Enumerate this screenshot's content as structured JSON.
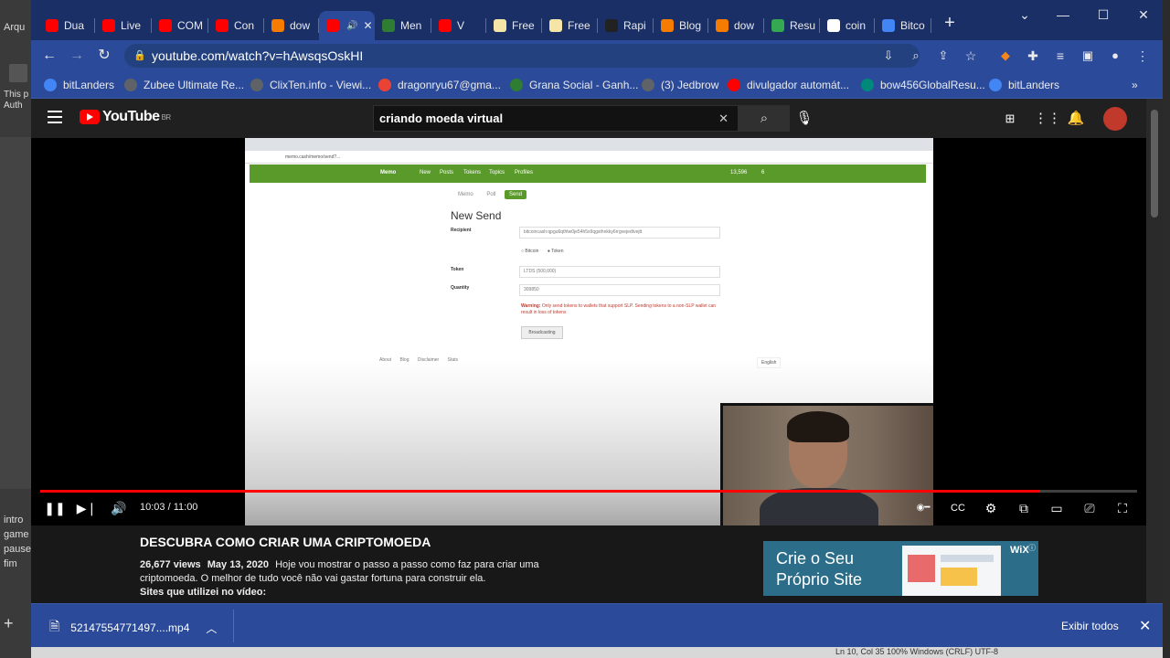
{
  "desktop": {
    "left_labels": [
      "Arqu",
      "This p",
      "Auth",
      "intro",
      "game",
      "pause",
      "fim"
    ],
    "add_label": "+"
  },
  "tabs": [
    {
      "label": "Dua",
      "icon": "youtube-icon",
      "color": "#ff0000"
    },
    {
      "label": "Live",
      "icon": "youtube-icon",
      "color": "#ff0000"
    },
    {
      "label": "COM",
      "icon": "youtube-icon",
      "color": "#ff0000"
    },
    {
      "label": "Con",
      "icon": "youtube-icon",
      "color": "#ff0000"
    },
    {
      "label": "dow",
      "icon": "blogger-icon",
      "color": "#f57c00"
    },
    {
      "label": "",
      "icon": "youtube-icon",
      "color": "#ff0000",
      "active": true
    },
    {
      "label": "Men",
      "icon": "money-icon",
      "color": "#2e7d32"
    },
    {
      "label": "V",
      "icon": "youtube-icon",
      "color": "#ff0000"
    },
    {
      "label": "Free",
      "icon": "freebitco-icon",
      "color": "#f5e6a8"
    },
    {
      "label": "Free",
      "icon": "freebitco-icon",
      "color": "#f5e6a8"
    },
    {
      "label": "Rapi",
      "icon": "r-icon",
      "color": "#222222"
    },
    {
      "label": "Blog",
      "icon": "blogger-icon",
      "color": "#f57c00"
    },
    {
      "label": "dow",
      "icon": "blogger-icon",
      "color": "#f57c00"
    },
    {
      "label": "Resu",
      "icon": "play-icon",
      "color": "#34a853"
    },
    {
      "label": "coin",
      "icon": "google-icon",
      "color": "#ffffff"
    },
    {
      "label": "Bitco",
      "icon": "chrome-icon",
      "color": "#4285f4"
    }
  ],
  "address_bar": {
    "url": "youtube.com/watch?v=hAwsqsOskHI"
  },
  "bookmarks": [
    {
      "label": "bitLanders",
      "icon": "chrome-icon"
    },
    {
      "label": "Zubee Ultimate Re...",
      "icon": "web-icon"
    },
    {
      "label": "ClixTen.info - Viewi...",
      "icon": "web-icon"
    },
    {
      "label": "dragonryu67@gma...",
      "icon": "google-icon"
    },
    {
      "label": "Grana Social - Ganh...",
      "icon": "money-icon"
    },
    {
      "label": "(3) Jedbrow",
      "icon": "web-icon"
    },
    {
      "label": "divulgador automát...",
      "icon": "youtube-icon"
    },
    {
      "label": "bow456GlobalResu...",
      "icon": "puzzle-icon"
    },
    {
      "label": "bitLanders",
      "icon": "chrome-icon"
    }
  ],
  "youtube": {
    "logo_text": "YouTube",
    "region": "BR",
    "search_query": "criando moeda virtual",
    "clear_symbol": "✕"
  },
  "embedded_page": {
    "url": "memo.cash/memo/send?...",
    "nav_brand": "Memo",
    "nav_items": [
      "New",
      "Posts",
      "Tokens",
      "Topics",
      "Profiles"
    ],
    "nav_balance": "13,596",
    "nav_count": "6",
    "tabs": [
      "Memo",
      "Poll",
      "Send"
    ],
    "title": "New Send",
    "recipient_label": "Recipient",
    "recipient_value": "bitcoincash:qpgu6qthtw0je54h5x9qgsthnkky6rrgvejedtvejtt",
    "radio_bitcoin": "Bitcoin",
    "radio_token": "Token",
    "token_label": "Token",
    "token_value": "LTDS (500,000)",
    "quantity_label": "Quantity",
    "quantity_value": "309850",
    "warning_bold": "Warning:",
    "warning_text": "Only send tokens to wallets that support SLP. Sending tokens to a non-SLP wallet can result in loss of tokens",
    "button_label": "Broadcasting",
    "footer_links": [
      "About",
      "Blog",
      "Disclaimer",
      "Stats"
    ],
    "language": "English"
  },
  "player": {
    "current_time": "10:03",
    "duration": "11:00",
    "progress_fraction": 0.9118
  },
  "video": {
    "title": "DESCUBRA COMO CRIAR UMA CRIPTOMOEDA",
    "views": "26,677 views",
    "date": "May 13, 2020",
    "description": "Hoje vou mostrar o passo a passo como faz para criar uma criptomoeda. O melhor de tudo você não vai gastar fortuna para construir ela.",
    "sites_line": "Sites que utilizei no vídeo:"
  },
  "ad": {
    "text": "Crie o Seu Próprio Site",
    "brand": "WiX"
  },
  "download_bar": {
    "filename": "52147554771497....mp4",
    "show_all": "Exibir todos"
  },
  "taskbar_bits": "Ln 10, Col 35     100%     Windows (CRLF)     UTF-8",
  "colors": {
    "chrome_blue": "#2b4a9a",
    "tab_strip": "#1a2f66",
    "youtube_red": "#ff0000",
    "memo_green": "#5a9a2b"
  }
}
